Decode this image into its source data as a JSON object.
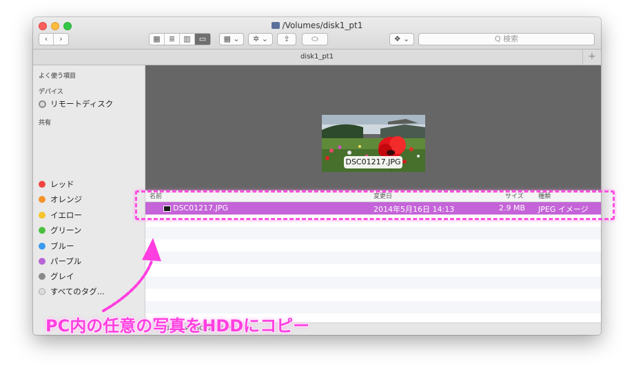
{
  "window": {
    "title": "/Volumes/disk1_pt1",
    "tab_title": "disk1_pt1",
    "tab_add": "+"
  },
  "toolbar": {
    "back": "‹",
    "forward": "›",
    "view_icon": "▦",
    "view_list": "≣",
    "view_columns": "▥",
    "view_coverflow": "▭",
    "arrange": "▦ ⌄",
    "action": "✲ ⌄",
    "share": "⇪",
    "tags": "⬭",
    "dropbox": "❖ ⌄"
  },
  "search": {
    "placeholder": "Q 検索"
  },
  "sidebar": {
    "favorites_header": "よく使う項目",
    "devices_header": "デバイス",
    "remote_disc": "リモートディスク",
    "shared_header": "共有",
    "tags": [
      {
        "label": "レッド",
        "color": "#f0453f"
      },
      {
        "label": "オレンジ",
        "color": "#f3932a"
      },
      {
        "label": "イエロー",
        "color": "#f5c42a"
      },
      {
        "label": "グリーン",
        "color": "#4ac03f"
      },
      {
        "label": "ブルー",
        "color": "#3a9af0"
      },
      {
        "label": "パープル",
        "color": "#b864d6"
      },
      {
        "label": "グレイ",
        "color": "#8a8a8a"
      },
      {
        "label": "すべてのタグ...",
        "color": "#dcdcdc"
      }
    ]
  },
  "preview": {
    "filename": "DSC01217.JPG"
  },
  "columns": {
    "name": "名前",
    "date": "変更日",
    "size": "サイズ",
    "kind": "種類"
  },
  "file_row": {
    "name": "DSC01217.JPG",
    "date": "2014年5月16日 14:13",
    "size": "2.9 MB",
    "kind": "JPEG イメージ"
  },
  "pathbar": {
    "text": "disk1_pt1 ▸ DSC01217.JPG"
  },
  "annotation": {
    "caption": "PC内の任意の写真をHDDにコピー",
    "color": "#ff3fe0"
  }
}
